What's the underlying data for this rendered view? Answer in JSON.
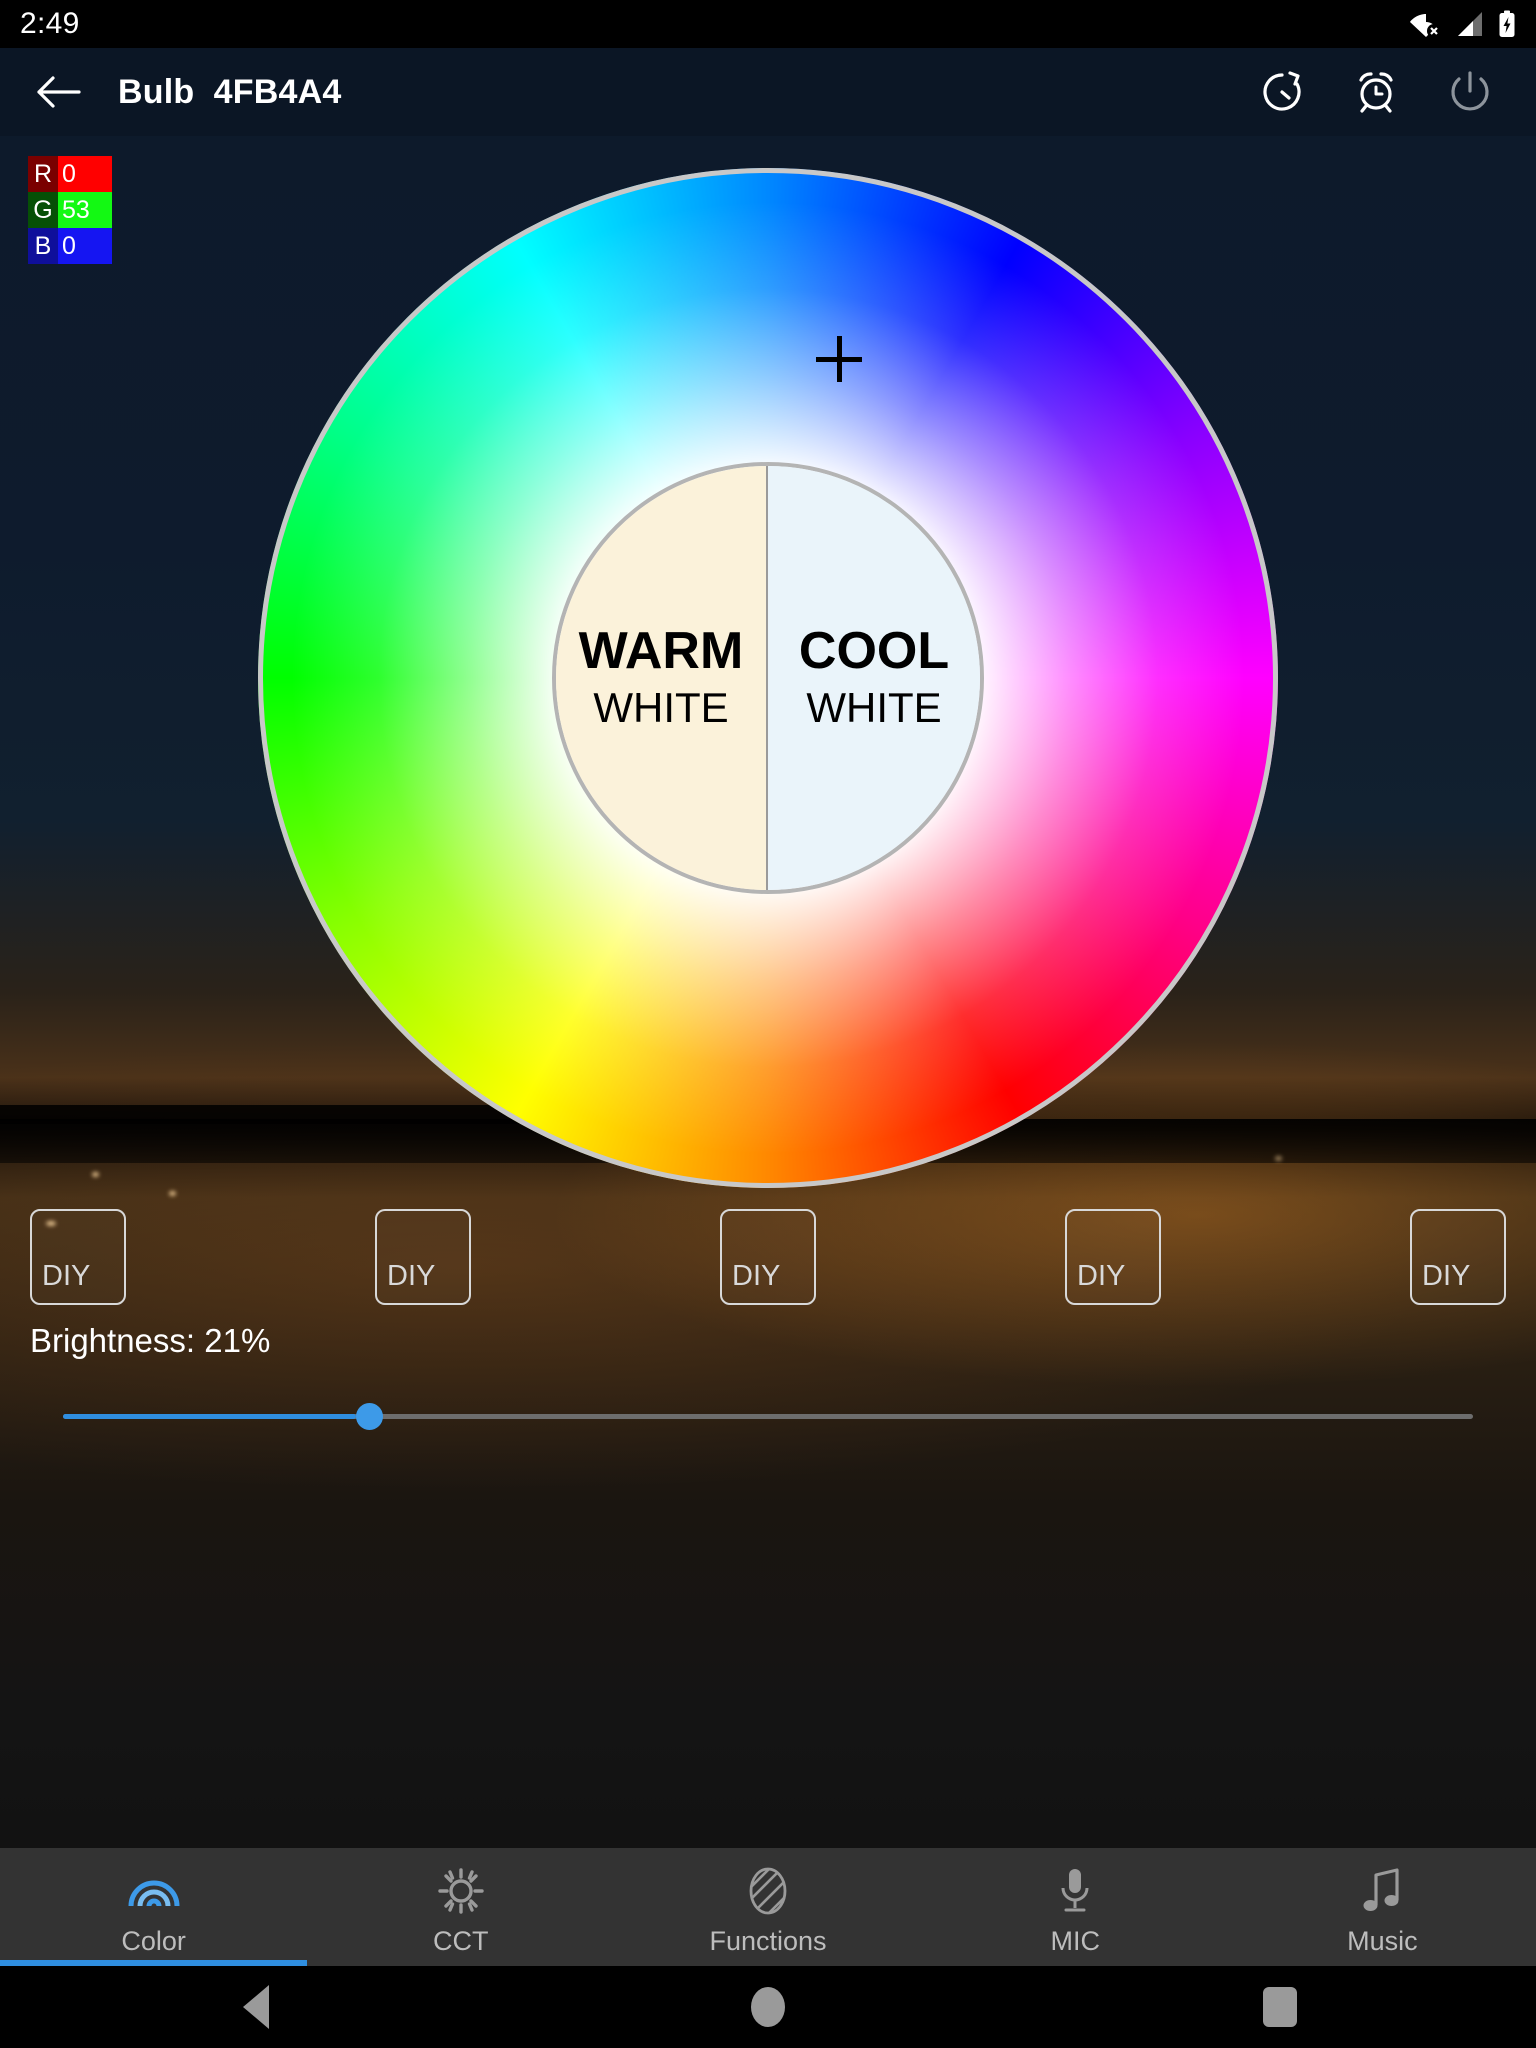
{
  "statusbar": {
    "time": "2:49",
    "icons": [
      "wifi-no-internet-icon",
      "cellular-signal-icon",
      "battery-charging-icon"
    ]
  },
  "appbar": {
    "back_icon": "arrow-left-icon",
    "title": "Bulb  4FB4A4",
    "actions": [
      {
        "name": "timer-icon",
        "label": "Timer"
      },
      {
        "name": "alarm-icon",
        "label": "Alarm"
      },
      {
        "name": "power-icon",
        "label": "Power"
      }
    ]
  },
  "rgb": {
    "rows": [
      {
        "key": "R",
        "value": "0"
      },
      {
        "key": "G",
        "value": "53"
      },
      {
        "key": "B",
        "value": "0"
      }
    ]
  },
  "wheel": {
    "inner": {
      "warm": {
        "big": "WARM",
        "small": "WHITE"
      },
      "cool": {
        "big": "COOL",
        "small": "WHITE"
      }
    },
    "marker": "crosshair-marker"
  },
  "diy": {
    "buttons": [
      {
        "label": "DIY"
      },
      {
        "label": "DIY"
      },
      {
        "label": "DIY"
      },
      {
        "label": "DIY"
      },
      {
        "label": "DIY"
      }
    ]
  },
  "brightness": {
    "label": "Brightness: 21%",
    "value": 21
  },
  "tabs": [
    {
      "label": "Color",
      "icon": "rainbow-icon",
      "active": true
    },
    {
      "label": "CCT",
      "icon": "sun-icon",
      "active": false
    },
    {
      "label": "Functions",
      "icon": "hatched-oval-icon",
      "active": false
    },
    {
      "label": "MIC",
      "icon": "microphone-icon",
      "active": false
    },
    {
      "label": "Music",
      "icon": "music-note-icon",
      "active": false
    }
  ],
  "navbar": {
    "back": "android-back-icon",
    "home": "android-home-icon",
    "recents": "android-recents-icon"
  },
  "colors": {
    "accent": "#2f8ee0",
    "appbar_bg": "#0b1625",
    "tabbar_bg": "#333333",
    "warm_white": "#fbf2da",
    "cool_white": "#eaf4fa",
    "red": "#ff0000",
    "green": "#13f913",
    "blue": "#1515f2"
  }
}
